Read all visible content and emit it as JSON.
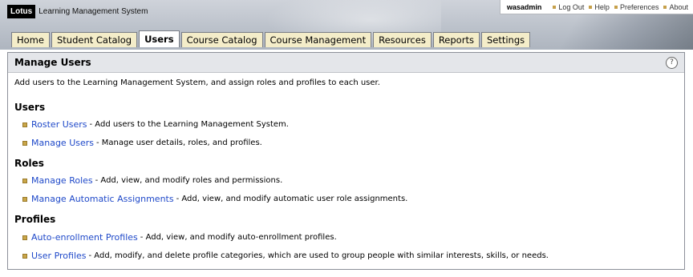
{
  "header": {
    "logo": "Lotus",
    "app_name": "Learning Management System",
    "user": "wasadmin",
    "links": [
      "Log Out",
      "Help",
      "Preferences",
      "About"
    ]
  },
  "tabs": [
    "Home",
    "Student Catalog",
    "Users",
    "Course Catalog",
    "Course Management",
    "Resources",
    "Reports",
    "Settings"
  ],
  "active_tab": "Users",
  "panel": {
    "title": "Manage Users",
    "help": "?",
    "intro": "Add users to the Learning Management System, and assign roles and profiles to each user.",
    "sections": [
      {
        "heading": "Users",
        "items": [
          {
            "link": "Roster Users",
            "desc": "- Add users to the Learning Management System."
          },
          {
            "link": "Manage Users",
            "desc": "- Manage user details, roles, and profiles."
          }
        ]
      },
      {
        "heading": "Roles",
        "items": [
          {
            "link": "Manage Roles",
            "desc": "- Add, view, and modify roles and permissions."
          },
          {
            "link": "Manage Automatic Assignments",
            "desc": "- Add, view, and modify automatic user role assignments."
          }
        ]
      },
      {
        "heading": "Profiles",
        "items": [
          {
            "link": "Auto-enrollment Profiles",
            "desc": "- Add, view, and modify auto-enrollment profiles."
          },
          {
            "link": "User Profiles",
            "desc": "- Add, modify, and delete profile categories, which are used to group people with similar interests, skills, or needs."
          }
        ]
      }
    ]
  },
  "colors": {
    "tab_bg": "#f4edc9",
    "link": "#1f49c9",
    "bullet": "#c9a649",
    "panel_head": "#e4e6ea"
  }
}
